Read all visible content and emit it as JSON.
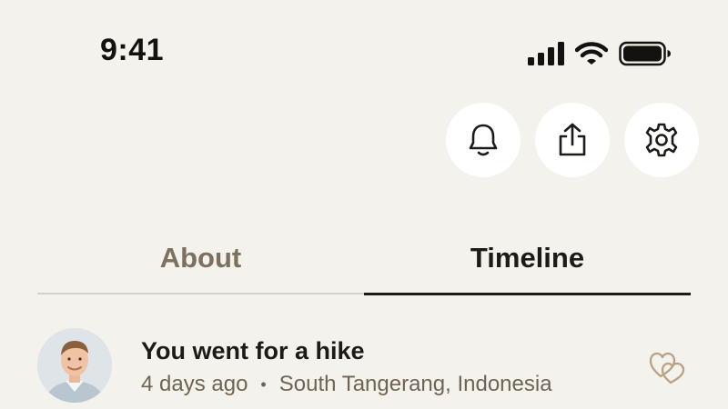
{
  "status_bar": {
    "time": "9:41",
    "icons": [
      "cellular-signal-icon",
      "wifi-icon",
      "battery-icon"
    ]
  },
  "actions": [
    {
      "icon": "bell-icon",
      "label": "Notifications"
    },
    {
      "icon": "share-icon",
      "label": "Share"
    },
    {
      "icon": "gear-icon",
      "label": "Settings"
    }
  ],
  "tabs": [
    {
      "label": "About",
      "active": false
    },
    {
      "label": "Timeline",
      "active": true
    }
  ],
  "timeline": {
    "items": [
      {
        "title": "You went for a hike",
        "time": "4 days ago",
        "separator": "•",
        "location": "South Tangerang, Indonesia",
        "icon": "hearts-icon"
      }
    ]
  },
  "colors": {
    "background": "#f4f2ec",
    "text_primary": "#1d1b18",
    "text_muted": "#7d705e",
    "like_icon": "#b9a284"
  }
}
